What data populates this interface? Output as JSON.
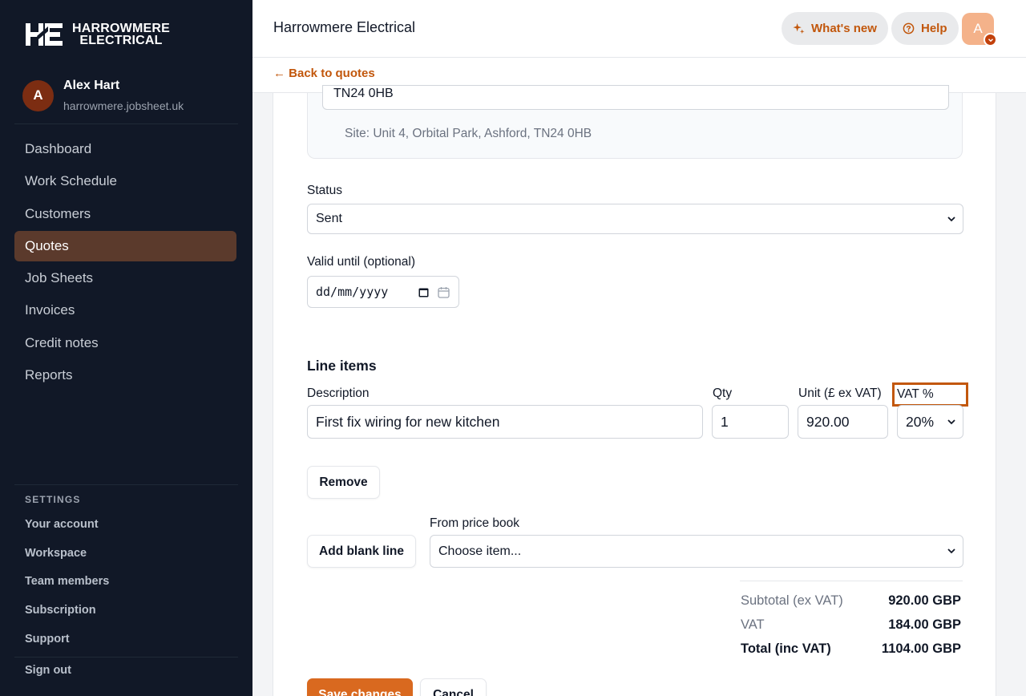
{
  "brand": {
    "line1": "HARROWMERE",
    "line2": "ELECTRICAL"
  },
  "user": {
    "initial": "A",
    "name": "Alex Hart",
    "domain": "harrowmere.jobsheet.uk"
  },
  "nav": {
    "items": [
      {
        "label": "Dashboard",
        "active": false
      },
      {
        "label": "Work Schedule",
        "active": false
      },
      {
        "label": "Customers",
        "active": false
      },
      {
        "label": "Quotes",
        "active": true
      },
      {
        "label": "Job Sheets",
        "active": false
      },
      {
        "label": "Invoices",
        "active": false
      },
      {
        "label": "Credit notes",
        "active": false
      },
      {
        "label": "Reports",
        "active": false
      }
    ]
  },
  "settings": {
    "label": "SETTINGS",
    "items": [
      "Your account",
      "Workspace",
      "Team members",
      "Subscription",
      "Support"
    ],
    "signout": "Sign out"
  },
  "header": {
    "title": "Harrowmere Electrical",
    "whats_new": "What's new",
    "help": "Help",
    "user_initial": "A"
  },
  "back": {
    "label": "← Back to quotes"
  },
  "form": {
    "postcode_value": "TN24 0HB",
    "site_text": "Site: Unit 4, Orbital Park, Ashford, TN24 0HB",
    "status_label": "Status",
    "status_value": "Sent",
    "valid_until_label": "Valid until (optional)",
    "valid_until_placeholder": "dd/mm/yyyy",
    "line_items_title": "Line items",
    "columns": {
      "description": "Description",
      "qty": "Qty",
      "unit": "Unit (£ ex VAT)",
      "vat": "VAT %"
    },
    "line": {
      "description": "First fix wiring for new kitchen",
      "qty": "1",
      "unit": "920.00",
      "vat": "20%"
    },
    "remove_label": "Remove",
    "add_blank_label": "Add blank line",
    "price_book_label": "From price book",
    "price_book_placeholder": "Choose item...",
    "summary": {
      "subtotal_label": "Subtotal (ex VAT)",
      "subtotal_value": "920.00 GBP",
      "vat_label": "VAT",
      "vat_value": "184.00 GBP",
      "total_label": "Total (inc VAT)",
      "total_value": "1104.00 GBP"
    },
    "save_label": "Save changes",
    "cancel_label": "Cancel"
  },
  "colors": {
    "accent": "#c2570c",
    "sidebar_bg": "#111827",
    "active_nav": "#5b3a2c",
    "primary_button": "#d9691f"
  }
}
